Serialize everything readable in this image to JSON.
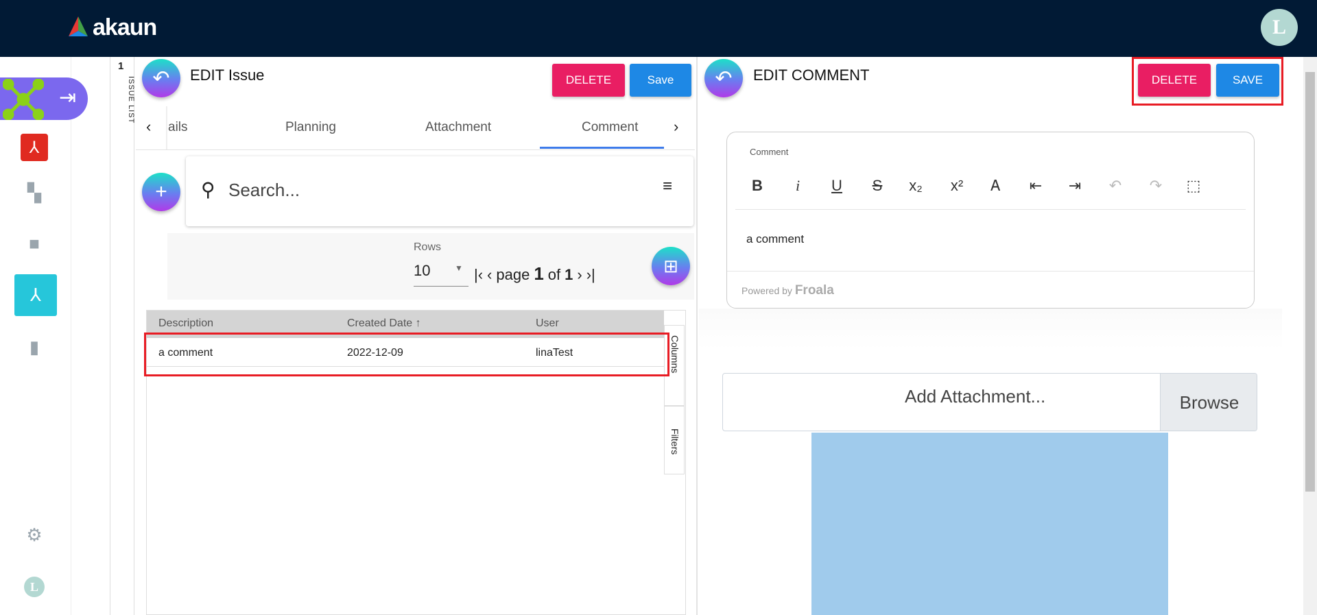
{
  "header": {
    "logo": "akaun",
    "avatar_letter": "L"
  },
  "sidebar": {
    "items": [
      "applet-menu",
      "acrobat",
      "dashboard",
      "inventory",
      "issue-tracker",
      "reports",
      "settings",
      "profile"
    ]
  },
  "strip": {
    "count": "1",
    "label": "ISSUE LIST"
  },
  "left_panel": {
    "title": "EDIT Issue",
    "delete_label": "DELETE",
    "save_label": "Save",
    "tabs": [
      "ails",
      "Planning",
      "Attachment",
      "Comment"
    ],
    "search_placeholder": "Search...",
    "rows_label": "Rows",
    "rows_value": "10",
    "pager": {
      "page_word": "page",
      "page": "1",
      "of_word": "of",
      "total": "1"
    },
    "table": {
      "columns": [
        "Description",
        "Created Date ↑",
        "User"
      ],
      "rows": [
        {
          "description": "a comment",
          "created_date": "2022-12-09",
          "user": "linaTest"
        }
      ]
    },
    "side_tabs": {
      "columns": "Columns",
      "filters": "Filters"
    }
  },
  "right_panel": {
    "title": "EDIT COMMENT",
    "delete_label": "DELETE",
    "save_label": "SAVE",
    "editor": {
      "label": "Comment",
      "content": "a comment",
      "powered_by": "Powered by",
      "brand": "Froala"
    },
    "attachment": {
      "placeholder": "Add Attachment...",
      "browse_label": "Browse"
    }
  },
  "colors": {
    "header": "#011a35",
    "delete": "#e91e63",
    "save": "#1e88e5",
    "highlight": "#e81c24",
    "preview": "#a0cbec"
  }
}
